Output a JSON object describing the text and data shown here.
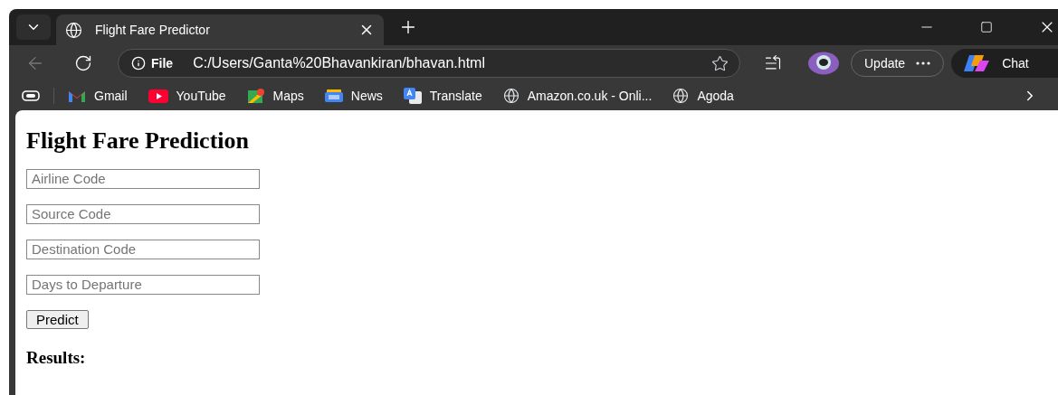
{
  "tabs": [
    {
      "title": "Flight Fare Predictor",
      "selected": true
    }
  ],
  "address": {
    "scheme": "File",
    "url": "C:/Users/Ganta%20Bhavankiran/bhavan.html"
  },
  "toolbar": {
    "update": "Update",
    "chat": "Chat"
  },
  "bookmarks": [
    {
      "label": "Gmail",
      "kind": "gmail"
    },
    {
      "label": "YouTube",
      "kind": "youtube"
    },
    {
      "label": "Maps",
      "kind": "maps"
    },
    {
      "label": "News",
      "kind": "news"
    },
    {
      "label": "Translate",
      "kind": "translate"
    },
    {
      "label": "Amazon.co.uk - Onli...",
      "kind": "globe"
    },
    {
      "label": "Agoda",
      "kind": "globe"
    }
  ],
  "page": {
    "heading": "Flight Fare Prediction",
    "fields": [
      {
        "placeholder": "Airline Code"
      },
      {
        "placeholder": "Source Code"
      },
      {
        "placeholder": "Destination Code"
      },
      {
        "placeholder": "Days to Departure"
      }
    ],
    "button": "Predict",
    "results": "Results:"
  }
}
